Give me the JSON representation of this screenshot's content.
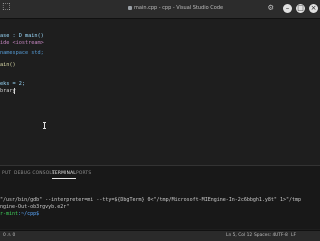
{
  "titlebar": {
    "left_glyph": "⬚",
    "title": "main.cpp - cpp - Visual Studio Code",
    "buttons": {
      "minimize": "–",
      "maximize": "□",
      "close": "×"
    },
    "settings_icon": "gear-icon"
  },
  "editor": {
    "lines": [
      "",
      "",
      "ase : D main()",
      "ide <iostream>",
      "",
      "namespace std;",
      "",
      "ain()",
      "",
      "",
      "eks = 2;",
      "brary"
    ]
  },
  "panel": {
    "tabs": [
      {
        "label": "PUT",
        "active": false
      },
      {
        "label": "DEBUG CONSOLE",
        "active": false
      },
      {
        "label": "TERMINAL",
        "active": true
      },
      {
        "label": "PORTS",
        "active": false
      }
    ],
    "terminal": {
      "command": "\"/usr/bin/gdb\" --interpreter=mi --tty=${DbgTerm} 0<\"/tmp/Microsoft-MIEngine-In-2c6bbgh1.y8t\" 1>\"/tmp",
      "output": "ngine-Out-ob3rgvyb.e2r\"",
      "prompt_user": "r-mint",
      "prompt_path": ":~/cpp$"
    }
  },
  "statusbar": {
    "left": "0 ⚠ 0",
    "position": "Ln 5, Col 12",
    "spaces": "Spaces: 4",
    "encoding": "UTF-8",
    "eol": "LF"
  }
}
